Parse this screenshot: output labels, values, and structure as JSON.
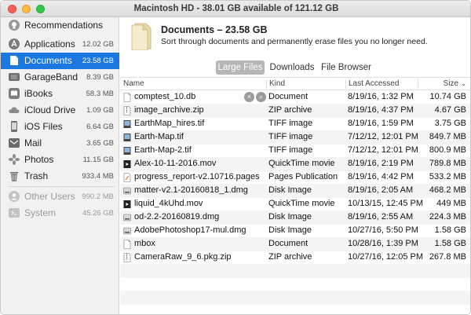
{
  "window": {
    "title": "Macintosh HD - 38.01 GB available of 121.12 GB"
  },
  "sidebar": {
    "items": [
      {
        "label": "Recommendations",
        "size": "",
        "icon": "lightbulb-icon"
      },
      {
        "label": "Applications",
        "size": "12.02 GB",
        "icon": "applications-icon"
      },
      {
        "label": "Documents",
        "size": "23.58 GB",
        "icon": "documents-icon",
        "selected": true
      },
      {
        "label": "GarageBand",
        "size": "8.39 GB",
        "icon": "garageband-icon"
      },
      {
        "label": "iBooks",
        "size": "58.3 MB",
        "icon": "ibooks-icon"
      },
      {
        "label": "iCloud Drive",
        "size": "1.09 GB",
        "icon": "icloud-icon"
      },
      {
        "label": "iOS Files",
        "size": "6.64 GB",
        "icon": "ios-device-icon"
      },
      {
        "label": "Mail",
        "size": "3.65 GB",
        "icon": "mail-icon"
      },
      {
        "label": "Photos",
        "size": "11.15 GB",
        "icon": "photos-icon"
      },
      {
        "label": "Trash",
        "size": "933.4 MB",
        "icon": "trash-icon"
      },
      {
        "label": "Other Users",
        "size": "990.2 MB",
        "icon": "other-users-icon",
        "dim": true
      },
      {
        "label": "System",
        "size": "45.26 GB",
        "icon": "system-icon",
        "dim": true
      }
    ]
  },
  "banner": {
    "title": "Documents – 23.58 GB",
    "subtitle": "Sort through documents and permanently erase files you no longer need."
  },
  "tabs": [
    {
      "label": "Large Files",
      "active": true
    },
    {
      "label": "Downloads",
      "active": false
    },
    {
      "label": "File Browser",
      "active": false
    }
  ],
  "columns": {
    "name": "Name",
    "kind": "Kind",
    "accessed": "Last Accessed",
    "size": "Size"
  },
  "files": [
    {
      "name": "comptest_10.db",
      "kind": "Document",
      "accessed": "8/19/16, 1:32 PM",
      "size": "10.74 GB"
    },
    {
      "name": "image_archive.zip",
      "kind": "ZIP archive",
      "accessed": "8/19/16, 4:37 PM",
      "size": "4.67 GB"
    },
    {
      "name": "EarthMap_hires.tif",
      "kind": "TIFF image",
      "accessed": "8/19/16, 1:59 PM",
      "size": "3.75 GB"
    },
    {
      "name": "Earth-Map.tif",
      "kind": "TIFF image",
      "accessed": "7/12/12, 12:01 PM",
      "size": "849.7 MB"
    },
    {
      "name": "Earth-Map-2.tif",
      "kind": "TIFF image",
      "accessed": "7/12/12, 12:01 PM",
      "size": "800.9 MB"
    },
    {
      "name": "Alex-10-11-2016.mov",
      "kind": "QuickTime movie",
      "accessed": "8/19/16, 2:19 PM",
      "size": "789.8 MB"
    },
    {
      "name": "progress_report-v2.10716.pages",
      "kind": "Pages Publication",
      "accessed": "8/19/16, 4:42 PM",
      "size": "533.2 MB"
    },
    {
      "name": "matter-v2.1-20160818_1.dmg",
      "kind": "Disk Image",
      "accessed": "8/19/16, 2:05 AM",
      "size": "468.2 MB"
    },
    {
      "name": "liquid_4kUhd.mov",
      "kind": "QuickTime movie",
      "accessed": "10/13/15, 12:45 PM",
      "size": "449 MB"
    },
    {
      "name": "od-2.2-20160819.dmg",
      "kind": "Disk Image",
      "accessed": "8/19/16, 2:55 AM",
      "size": "224.3 MB"
    },
    {
      "name": "AdobePhotoshop17-mul.dmg",
      "kind": "Disk Image",
      "accessed": "10/27/16, 5:50 PM",
      "size": "1.58 GB"
    },
    {
      "name": "mbox",
      "kind": "Document",
      "accessed": "10/28/16, 1:39 PM",
      "size": "1.58 GB"
    },
    {
      "name": "CameraRaw_9_6.pkg.zip",
      "kind": "ZIP archive",
      "accessed": "10/27/16, 12:05 PM",
      "size": "267.8 MB"
    }
  ],
  "row_actions": {
    "remove_glyph": "×",
    "reveal_glyph": "⌕"
  }
}
